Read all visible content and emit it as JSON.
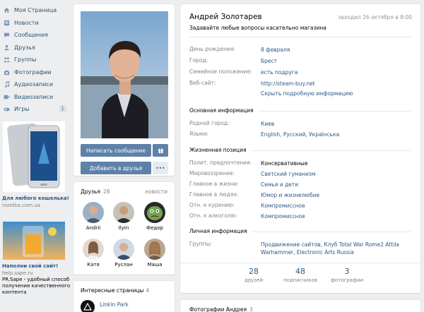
{
  "menu": [
    {
      "label": "Моя Страница",
      "icon": "home-icon"
    },
    {
      "label": "Новости",
      "icon": "news-icon"
    },
    {
      "label": "Сообщения",
      "icon": "messages-icon"
    },
    {
      "label": "Друзья",
      "icon": "friends-icon"
    },
    {
      "label": "Группы",
      "icon": "groups-icon"
    },
    {
      "label": "Фотографии",
      "icon": "camera-icon"
    },
    {
      "label": "Аудиозаписи",
      "icon": "music-icon"
    },
    {
      "label": "Видеозаписи",
      "icon": "video-icon"
    },
    {
      "label": "Игры",
      "icon": "gamepad-icon",
      "count": "1"
    }
  ],
  "ads": [
    {
      "title": "Для любого кошелька!",
      "sub": "rozetka.com.ua",
      "text": ""
    },
    {
      "title": "Наполни свой сайт!",
      "sub": "help.sape.ru",
      "text": "PR.Sape - удобный способ получения качественного контента"
    }
  ],
  "profile": {
    "buttons": {
      "message": "Написать сообщение",
      "add": "Добавить в друзья",
      "more": "•••"
    }
  },
  "friends": {
    "title": "Друзья",
    "count": "28",
    "link": "новости",
    "items": [
      {
        "name": "Andrii",
        "color": "#6b7e8f"
      },
      {
        "name": "Ilyin",
        "color": "#8a6a52"
      },
      {
        "name": "Федор",
        "color": "#5d8a3c"
      },
      {
        "name": "Катя",
        "color": "#b99a86"
      },
      {
        "name": "Руслан",
        "color": "#7b8aa0"
      },
      {
        "name": "Маша",
        "color": "#9b8a7a"
      }
    ]
  },
  "pages": {
    "title": "Интересные страницы",
    "count": "4",
    "items": [
      {
        "name": "Linkin Park"
      }
    ]
  },
  "info": {
    "name": "Андрей Золотарев",
    "last_seen": "заходил 26 октября в 8:00",
    "status": "Задавайте любые вопросы касательно магазина",
    "basic": [
      {
        "label": "День рождения:",
        "value": "8 февраля"
      },
      {
        "label": "Город:",
        "value": "Брест"
      },
      {
        "label": "Семейное положение:",
        "value": "есть подруга"
      },
      {
        "label": "Веб-сайт:",
        "value": "http://steam-buy.net"
      }
    ],
    "show_more": "Скрыть подробную информацию",
    "sections": {
      "main": "Основная информация",
      "position": "Жизненная позиция",
      "personal": "Личная информация"
    },
    "main_rows": [
      {
        "label": "Родной город:",
        "value": "Киев"
      },
      {
        "label": "Языки:",
        "value": "English, Русский, Українська"
      }
    ],
    "position_rows": [
      {
        "label": "Полит. предпочтения:",
        "value": "Консервативные"
      },
      {
        "label": "Мировоззрение:",
        "value": "Светский гуманизм"
      },
      {
        "label": "Главное в жизни:",
        "value": "Семья и дети"
      },
      {
        "label": "Главное в людях:",
        "value": "Юмор и жизнелюбие"
      },
      {
        "label": "Отн. к курению:",
        "value": "Компромиссное"
      },
      {
        "label": "Отн. к алкоголю:",
        "value": "Компромиссное"
      }
    ],
    "personal_rows": [
      {
        "label": "Группы:",
        "value": "Продвижение сайтов, Клуб Total War Rome2 Attila Warhammer, Electronic Arts Russia"
      }
    ],
    "counters": [
      {
        "num": "28",
        "label": "друзей"
      },
      {
        "num": "48",
        "label": "подписчиков"
      },
      {
        "num": "3",
        "label": "фотографии"
      }
    ]
  },
  "photos": {
    "title": "Фотографии Андрея",
    "count": "3"
  }
}
